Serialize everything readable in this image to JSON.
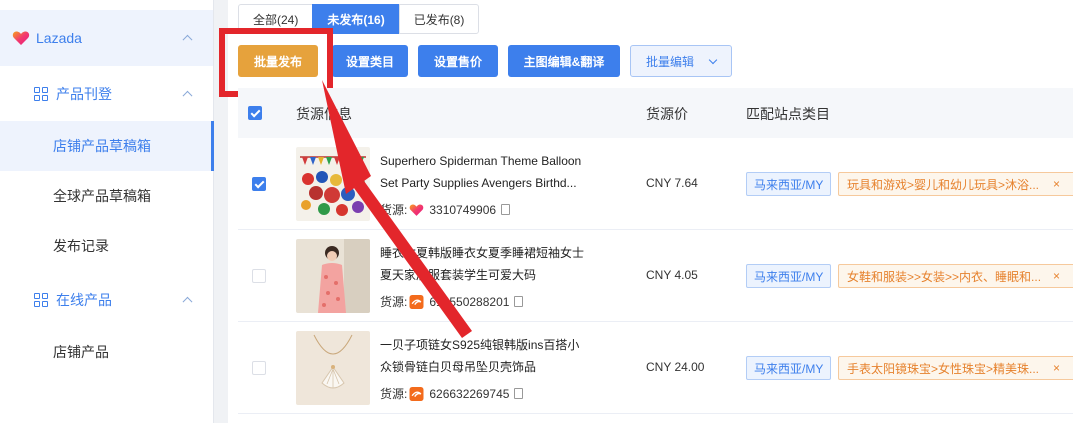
{
  "sidebar": {
    "platform": "Lazada",
    "groups": [
      {
        "label": "产品刊登",
        "items": [
          "店铺产品草稿箱",
          "全球产品草稿箱",
          "发布记录"
        ]
      },
      {
        "label": "在线产品",
        "items": [
          "店铺产品"
        ]
      }
    ],
    "active_item": "店铺产品草稿箱"
  },
  "tabs": [
    {
      "label": "全部(24)"
    },
    {
      "label": "未发布(16)",
      "active": true
    },
    {
      "label": "已发布(8)"
    }
  ],
  "toolbar": {
    "bulk_publish": "批量发布",
    "set_category": "设置类目",
    "set_price": "设置售价",
    "main_image_edit": "主图编辑&翻译",
    "bulk_edit": "批量编辑"
  },
  "table": {
    "headers": {
      "source_info": "货源信息",
      "source_price": "货源价",
      "site_category": "匹配站点类目"
    },
    "source_prefix": "货源:",
    "rows": [
      {
        "checked": true,
        "title_line1": "Superhero Spiderman Theme Balloon",
        "title_line2": "Set Party Supplies Avengers Birthd...",
        "source_icon": "lazada-heart-icon",
        "source_id": "3310749906",
        "price": "CNY 7.64",
        "site": "马来西亚/MY",
        "category": "玩具和游戏>婴儿和幼儿玩具>沐浴..."
      },
      {
        "checked": false,
        "title_line1": "睡衣女夏韩版睡衣女夏季睡裙短袖女士",
        "title_line2": "夏天家居服套装学生可爱大码",
        "source_icon": "1688-icon",
        "source_id": "614550288201",
        "price": "CNY 4.05",
        "site": "马来西亚/MY",
        "category": "女鞋和服装>>女装>>内衣、睡眠和..."
      },
      {
        "checked": false,
        "title_line1": "一贝子项链女S925纯银韩版ins百搭小",
        "title_line2": "众锁骨链白贝母吊坠贝壳饰品",
        "source_icon": "1688-icon",
        "source_id": "626632269745",
        "price": "CNY 24.00",
        "site": "马来西亚/MY",
        "category": "手表太阳镜珠宝>女性珠宝>精美珠..."
      }
    ]
  },
  "colors": {
    "primary": "#3d7fec",
    "orange": "#e6a23c",
    "highlight": "#e3262b"
  }
}
